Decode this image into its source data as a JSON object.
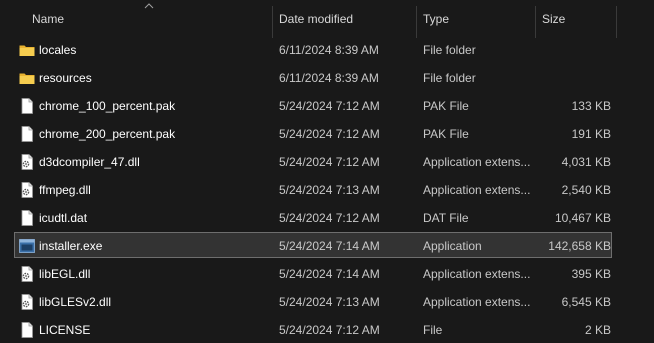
{
  "columns": {
    "name": "Name",
    "date": "Date modified",
    "type": "Type",
    "size": "Size"
  },
  "files": [
    {
      "name": "locales",
      "date": "6/11/2024 8:39 AM",
      "type": "File folder",
      "size": "",
      "icon": "folder-icon"
    },
    {
      "name": "resources",
      "date": "6/11/2024 8:39 AM",
      "type": "File folder",
      "size": "",
      "icon": "folder-icon"
    },
    {
      "name": "chrome_100_percent.pak",
      "date": "5/24/2024 7:12 AM",
      "type": "PAK File",
      "size": "133 KB",
      "icon": "file-icon"
    },
    {
      "name": "chrome_200_percent.pak",
      "date": "5/24/2024 7:12 AM",
      "type": "PAK File",
      "size": "191 KB",
      "icon": "file-icon"
    },
    {
      "name": "d3dcompiler_47.dll",
      "date": "5/24/2024 7:12 AM",
      "type": "Application extens...",
      "size": "4,031 KB",
      "icon": "dll-icon"
    },
    {
      "name": "ffmpeg.dll",
      "date": "5/24/2024 7:13 AM",
      "type": "Application extens...",
      "size": "2,540 KB",
      "icon": "dll-icon"
    },
    {
      "name": "icudtl.dat",
      "date": "5/24/2024 7:12 AM",
      "type": "DAT File",
      "size": "10,467 KB",
      "icon": "file-icon"
    },
    {
      "name": "installer.exe",
      "date": "5/24/2024 7:14 AM",
      "type": "Application",
      "size": "142,658 KB",
      "icon": "exe-icon",
      "selected": true
    },
    {
      "name": "libEGL.dll",
      "date": "5/24/2024 7:14 AM",
      "type": "Application extens...",
      "size": "395 KB",
      "icon": "dll-icon"
    },
    {
      "name": "libGLESv2.dll",
      "date": "5/24/2024 7:13 AM",
      "type": "Application extens...",
      "size": "6,545 KB",
      "icon": "dll-icon"
    },
    {
      "name": "LICENSE",
      "date": "5/24/2024 7:12 AM",
      "type": "File",
      "size": "2 KB",
      "icon": "file-icon"
    }
  ],
  "colors": {
    "background": "#191919",
    "selection": "#333333",
    "selection_border": "#6e6e6e",
    "folder": "#f4c542"
  }
}
